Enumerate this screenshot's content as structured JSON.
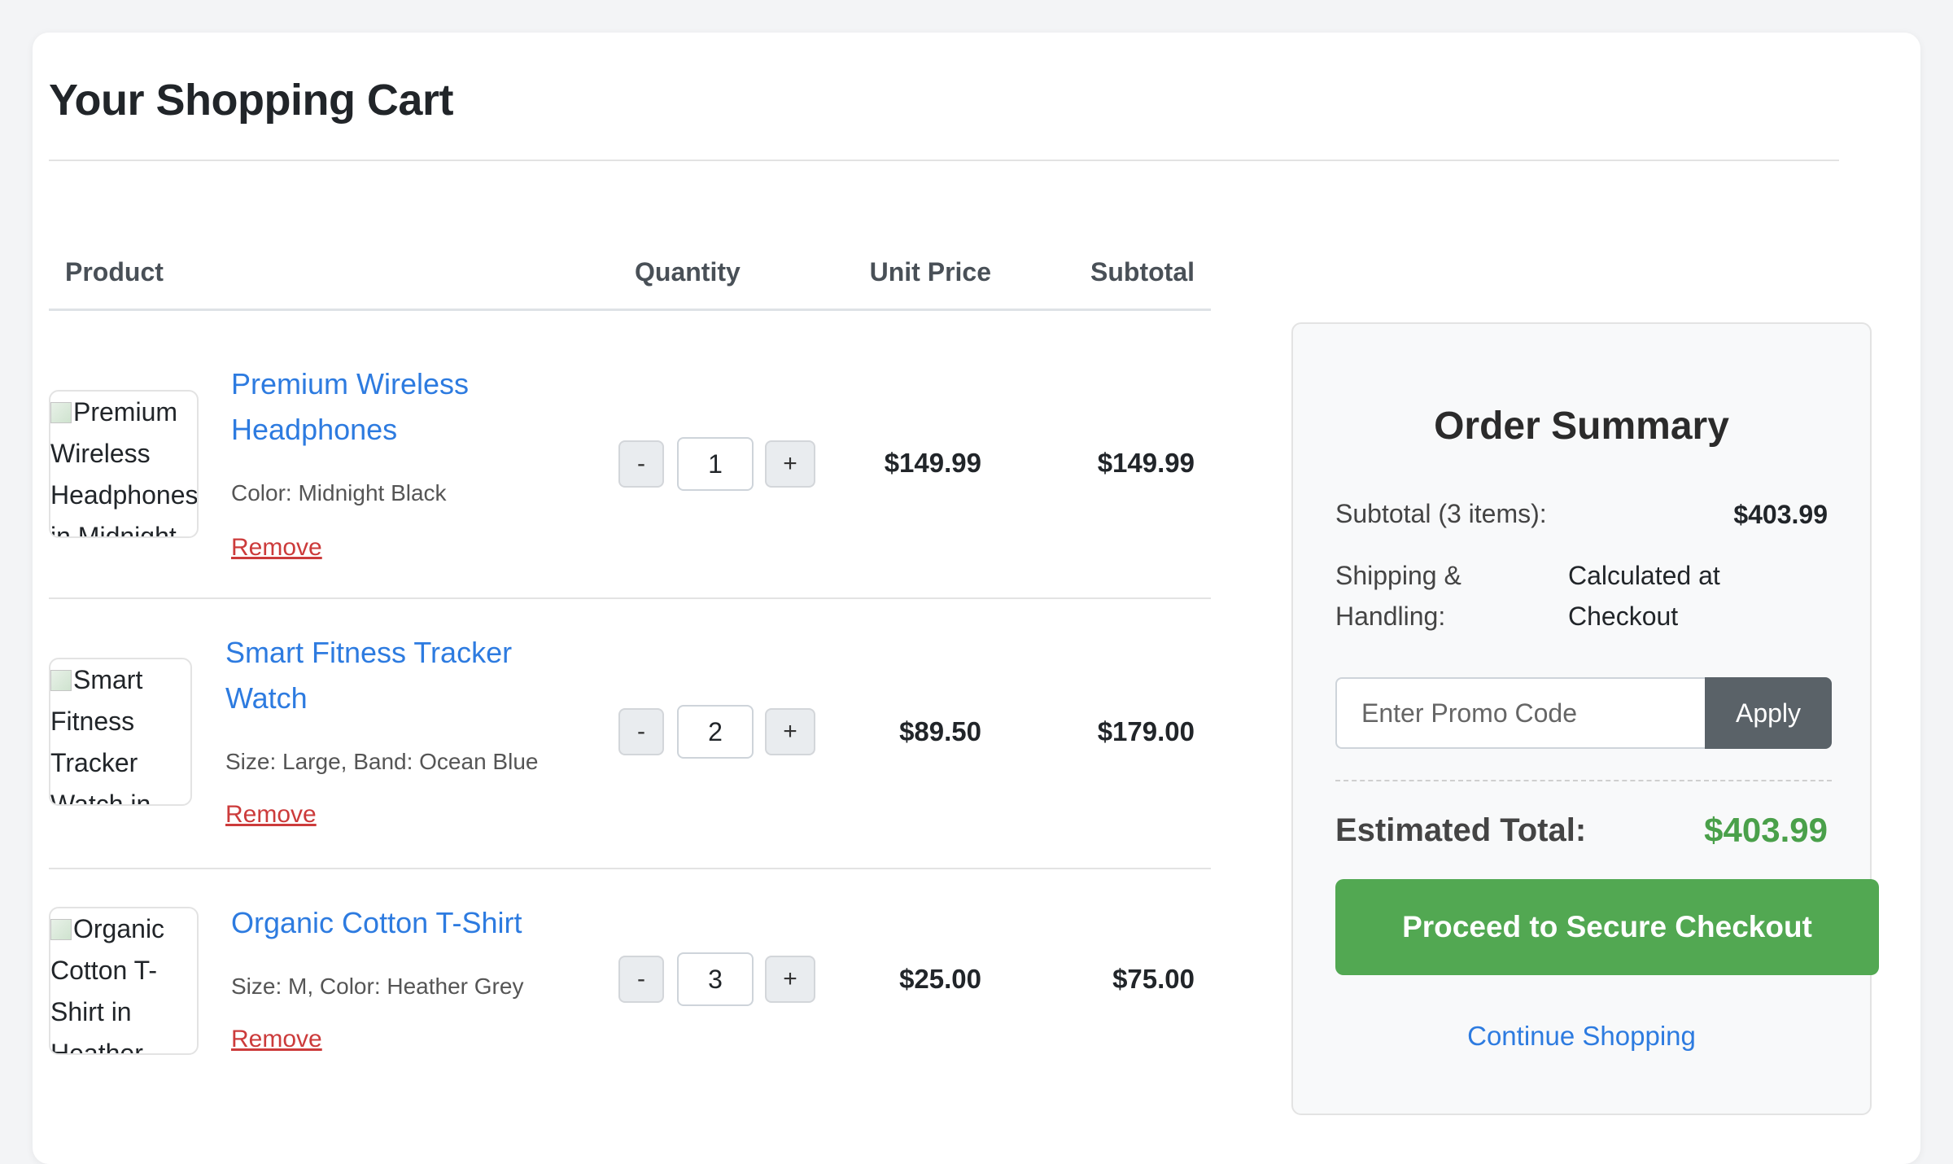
{
  "page": {
    "title": "Your Shopping Cart"
  },
  "table": {
    "headers": {
      "product": "Product",
      "quantity": "Quantity",
      "unit_price": "Unit Price",
      "subtotal": "Subtotal"
    },
    "items": [
      {
        "image_alt": "Premium Wireless Headphones in Midnight",
        "name_line1": "Premium Wireless",
        "name_line2": "Headphones",
        "meta": "Color: Midnight Black",
        "remove": "Remove",
        "qty_minus": "-",
        "quantity": "1",
        "qty_plus": "+",
        "unit_price": "$149.99",
        "subtotal": "$149.99"
      },
      {
        "image_alt": "Smart Fitness Tracker Watch in",
        "name_line1": "Smart Fitness Tracker",
        "name_line2": "Watch",
        "meta": "Size: Large, Band: Ocean Blue",
        "remove": "Remove",
        "qty_minus": "-",
        "quantity": "2",
        "qty_plus": "+",
        "unit_price": "$89.50",
        "subtotal": "$179.00"
      },
      {
        "image_alt": "Organic Cotton T-Shirt in Heather",
        "name_line1": "Organic Cotton T-Shirt",
        "name_line2": "",
        "meta": "Size: M, Color: Heather Grey",
        "remove": "Remove",
        "qty_minus": "-",
        "quantity": "3",
        "qty_plus": "+",
        "unit_price": "$25.00",
        "subtotal": "$75.00"
      }
    ]
  },
  "summary": {
    "title": "Order Summary",
    "subtotal_label": "Subtotal (3 items):",
    "subtotal_value": "$403.99",
    "shipping_label": "Shipping & Handling:",
    "shipping_value": "Calculated at Checkout",
    "promo_placeholder": "Enter Promo Code",
    "apply_label": "Apply",
    "total_label": "Estimated Total:",
    "total_value": "$403.99",
    "checkout_label": "Proceed to Secure Checkout",
    "continue_label": "Continue Shopping"
  },
  "colors": {
    "link": "#2d7be0",
    "remove": "#cc3b3b",
    "total": "#4aa04a",
    "checkout": "#52a852",
    "apply": "#5a6268"
  }
}
